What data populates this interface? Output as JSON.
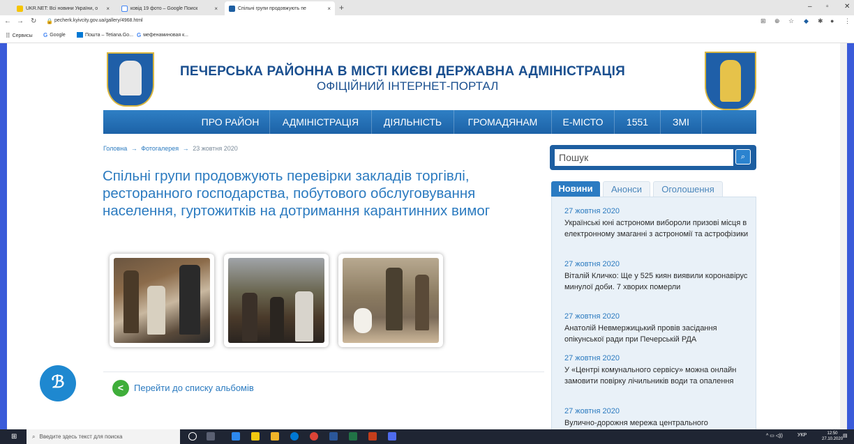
{
  "browser": {
    "tabs": [
      {
        "label": "UKR.NET: Всі новини України, о",
        "close": "×"
      },
      {
        "label": "ковід 19 фото – Google Поиск",
        "close": "×"
      },
      {
        "label": "Спільні групи продовжують пе",
        "close": "×"
      }
    ],
    "new_tab": "+",
    "url": "pecherk.kyivcity.gov.ua/gallery/4968.html",
    "bookmarks": [
      {
        "label": "Сервисы"
      },
      {
        "label": "Google"
      },
      {
        "label": "Пошта – Tetiana.Go..."
      },
      {
        "label": "мефенаминовая к..."
      }
    ]
  },
  "site": {
    "title_line1": "ПЕЧЕРСЬКА РАЙОННА В МІСТІ КИЄВІ ДЕРЖАВНА АДМІНІСТРАЦІЯ",
    "title_line2": "ОФІЦІЙНИЙ ІНТЕРНЕТ-ПОРТАЛ",
    "menu": [
      {
        "label": "ПРО РАЙОН"
      },
      {
        "label": "АДМІНІСТРАЦІЯ"
      },
      {
        "label": "ДІЯЛЬНІСТЬ"
      },
      {
        "label": "ГРОМАДЯНАМ"
      },
      {
        "label": "Е-МІСТО"
      },
      {
        "label": "1551"
      },
      {
        "label": "ЗМІ"
      }
    ]
  },
  "breadcrumb": {
    "home": "Головна",
    "gallery": "Фотогалерея",
    "date": "23 жовтня 2020",
    "separator": "→"
  },
  "article": {
    "title": "Спільні групи продовжують перевірки закладів торгівлі, ресторанного господарства, побутового обслуговування населення, гуртожитків на дотримання карантинних вимог",
    "back_icon": "<",
    "back_link": "Перейти до списку альбомів"
  },
  "sidebar": {
    "search_placeholder": "Пошук",
    "tabs": [
      {
        "label": "Новини"
      },
      {
        "label": "Анонси"
      },
      {
        "label": "Оголошення"
      }
    ],
    "news": [
      {
        "date": "27 жовтня 2020",
        "text": "Українські юні астрономи вибороли призові місця в електронному змаганні з астрономії та астрофізики"
      },
      {
        "date": "27 жовтня 2020",
        "text": "Віталій Кличко: Ще у 525 киян виявили коронавірус минулої доби. 7 хворих померли"
      },
      {
        "date": "27 жовтня 2020",
        "text": "Анатолій Невмержицький провів засідання опікунської ради при Печерській РДА"
      },
      {
        "date": "27 жовтня 2020",
        "text": "У «Центрі комунального сервісу» можна онлайн замовити повірку лічильників води та опалення"
      },
      {
        "date": "27 жовтня 2020",
        "text": "Вулично-дорожня мережа центрального"
      }
    ]
  },
  "taskbar": {
    "search_placeholder": "Введите здесь текст для поиска",
    "tray_lang": "УКР",
    "time": "12:50",
    "date": "27.10.2020"
  },
  "colors": {
    "menu_bar": "#1c62a7",
    "link": "#2c7bc0",
    "title": "#1a4f8f",
    "back_button": "#3fae3a"
  }
}
